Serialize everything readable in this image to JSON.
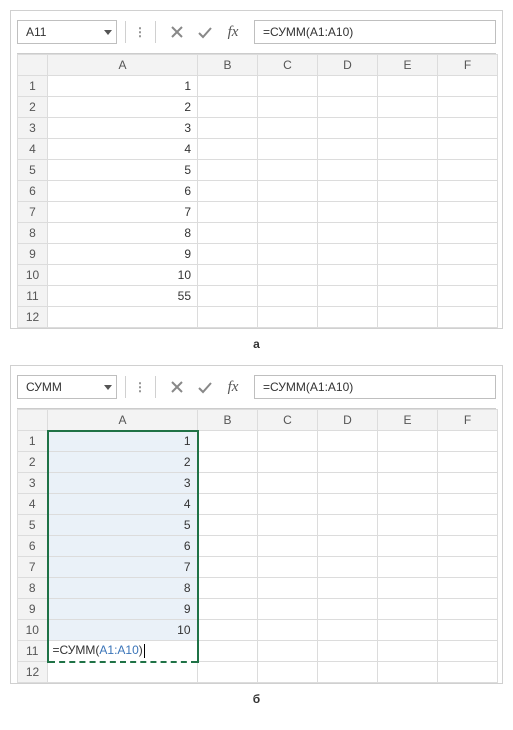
{
  "top": {
    "namebox": "A11",
    "formula": "=СУММ(A1:A10)",
    "columns": [
      "A",
      "B",
      "C",
      "D",
      "E",
      "F"
    ],
    "rows": [
      "1",
      "2",
      "3",
      "4",
      "5",
      "6",
      "7",
      "8",
      "9",
      "10",
      "11",
      "12"
    ],
    "colA": [
      "1",
      "2",
      "3",
      "4",
      "5",
      "6",
      "7",
      "8",
      "9",
      "10",
      "55",
      ""
    ]
  },
  "labelTop": "а",
  "bottom": {
    "namebox": "СУММ",
    "formula": "=СУММ(A1:A10)",
    "columns": [
      "A",
      "B",
      "C",
      "D",
      "E",
      "F"
    ],
    "rows": [
      "1",
      "2",
      "3",
      "4",
      "5",
      "6",
      "7",
      "8",
      "9",
      "10",
      "11",
      "12"
    ],
    "colA": [
      "1",
      "2",
      "3",
      "4",
      "5",
      "6",
      "7",
      "8",
      "9",
      "10"
    ],
    "editPrefix": "=СУММ(",
    "editRef": "A1:A10",
    "editSuffix": ")"
  },
  "labelBottom": "б",
  "chart_data": {
    "type": "table",
    "title": "Spreadsheet SUM example",
    "categories": [
      "A1",
      "A2",
      "A3",
      "A4",
      "A5",
      "A6",
      "A7",
      "A8",
      "A9",
      "A10",
      "A11"
    ],
    "values": [
      1,
      2,
      3,
      4,
      5,
      6,
      7,
      8,
      9,
      10,
      55
    ],
    "note": "A11 = СУММ(A1:A10) = 55"
  }
}
